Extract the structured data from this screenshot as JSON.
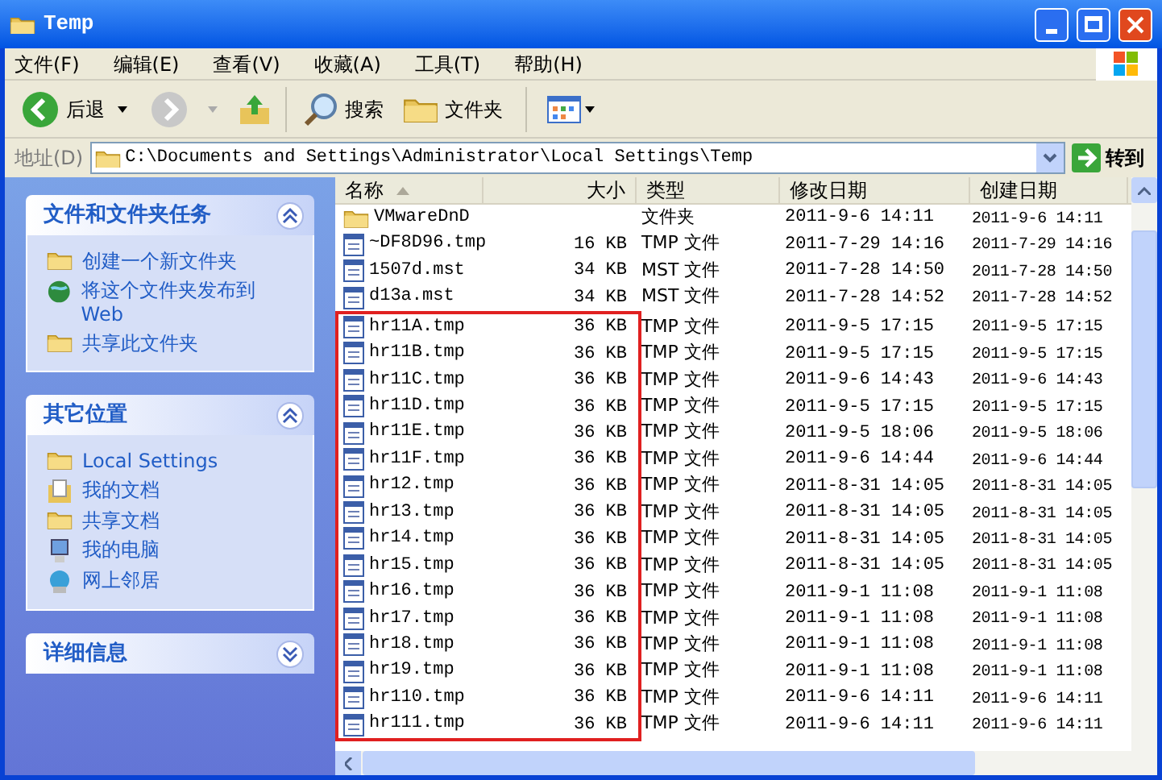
{
  "window": {
    "title": "Temp"
  },
  "menu": [
    "文件(F)",
    "编辑(E)",
    "查看(V)",
    "收藏(A)",
    "工具(T)",
    "帮助(H)"
  ],
  "toolbar": {
    "back": "后退",
    "search": "搜索",
    "folders": "文件夹"
  },
  "address": {
    "label": "地址(D)",
    "value": "C:\\Documents and Settings\\Administrator\\Local Settings\\Temp",
    "go": "转到"
  },
  "panels": [
    {
      "title": "文件和文件夹任务",
      "expanded": true,
      "items": [
        "创建一个新文件夹",
        "将这个文件夹发布到 Web",
        "共享此文件夹"
      ]
    },
    {
      "title": "其它位置",
      "expanded": true,
      "items": [
        "Local Settings",
        "我的文档",
        "共享文档",
        "我的电脑",
        "网上邻居"
      ]
    },
    {
      "title": "详细信息",
      "expanded": false
    }
  ],
  "columns": [
    {
      "label": "名称",
      "sorted": true
    },
    {
      "label": "大小",
      "sorted": false
    },
    {
      "label": "类型",
      "sorted": false
    },
    {
      "label": "修改日期",
      "sorted": false
    },
    {
      "label": "创建日期",
      "sorted": false
    }
  ],
  "rows": [
    {
      "kind": "folder",
      "name": "VMwareDnD",
      "size": "",
      "type": "文件夹",
      "modified": "2011-9-6 14:11",
      "created": "2011-9-6 14:11",
      "marked": false
    },
    {
      "kind": "file",
      "name": "~DF8D96.tmp",
      "size": "16 KB",
      "type": "TMP 文件",
      "modified": "2011-7-29 14:16",
      "created": "2011-7-29 14:16",
      "marked": false
    },
    {
      "kind": "file",
      "name": "1507d.mst",
      "size": "34 KB",
      "type": "MST 文件",
      "modified": "2011-7-28 14:50",
      "created": "2011-7-28 14:50",
      "marked": false
    },
    {
      "kind": "file",
      "name": "d13a.mst",
      "size": "34 KB",
      "type": "MST 文件",
      "modified": "2011-7-28 14:52",
      "created": "2011-7-28 14:52",
      "marked": false
    },
    {
      "kind": "file",
      "name": "hr11A.tmp",
      "size": "36 KB",
      "type": "TMP 文件",
      "modified": "2011-9-5 17:15",
      "created": "2011-9-5 17:15",
      "marked": true
    },
    {
      "kind": "file",
      "name": "hr11B.tmp",
      "size": "36 KB",
      "type": "TMP 文件",
      "modified": "2011-9-5 17:15",
      "created": "2011-9-5 17:15",
      "marked": true
    },
    {
      "kind": "file",
      "name": "hr11C.tmp",
      "size": "36 KB",
      "type": "TMP 文件",
      "modified": "2011-9-6 14:43",
      "created": "2011-9-6 14:43",
      "marked": true
    },
    {
      "kind": "file",
      "name": "hr11D.tmp",
      "size": "36 KB",
      "type": "TMP 文件",
      "modified": "2011-9-5 17:15",
      "created": "2011-9-5 17:15",
      "marked": true
    },
    {
      "kind": "file",
      "name": "hr11E.tmp",
      "size": "36 KB",
      "type": "TMP 文件",
      "modified": "2011-9-5 18:06",
      "created": "2011-9-5 18:06",
      "marked": true
    },
    {
      "kind": "file",
      "name": "hr11F.tmp",
      "size": "36 KB",
      "type": "TMP 文件",
      "modified": "2011-9-6 14:44",
      "created": "2011-9-6 14:44",
      "marked": true
    },
    {
      "kind": "file",
      "name": "hr12.tmp",
      "size": "36 KB",
      "type": "TMP 文件",
      "modified": "2011-8-31 14:05",
      "created": "2011-8-31 14:05",
      "marked": true
    },
    {
      "kind": "file",
      "name": "hr13.tmp",
      "size": "36 KB",
      "type": "TMP 文件",
      "modified": "2011-8-31 14:05",
      "created": "2011-8-31 14:05",
      "marked": true
    },
    {
      "kind": "file",
      "name": "hr14.tmp",
      "size": "36 KB",
      "type": "TMP 文件",
      "modified": "2011-8-31 14:05",
      "created": "2011-8-31 14:05",
      "marked": true
    },
    {
      "kind": "file",
      "name": "hr15.tmp",
      "size": "36 KB",
      "type": "TMP 文件",
      "modified": "2011-8-31 14:05",
      "created": "2011-8-31 14:05",
      "marked": true
    },
    {
      "kind": "file",
      "name": "hr16.tmp",
      "size": "36 KB",
      "type": "TMP 文件",
      "modified": "2011-9-1 11:08",
      "created": "2011-9-1 11:08",
      "marked": true
    },
    {
      "kind": "file",
      "name": "hr17.tmp",
      "size": "36 KB",
      "type": "TMP 文件",
      "modified": "2011-9-1 11:08",
      "created": "2011-9-1 11:08",
      "marked": true
    },
    {
      "kind": "file",
      "name": "hr18.tmp",
      "size": "36 KB",
      "type": "TMP 文件",
      "modified": "2011-9-1 11:08",
      "created": "2011-9-1 11:08",
      "marked": true
    },
    {
      "kind": "file",
      "name": "hr19.tmp",
      "size": "36 KB",
      "type": "TMP 文件",
      "modified": "2011-9-1 11:08",
      "created": "2011-9-1 11:08",
      "marked": true
    },
    {
      "kind": "file",
      "name": "hr110.tmp",
      "size": "36 KB",
      "type": "TMP 文件",
      "modified": "2011-9-6 14:11",
      "created": "2011-9-6 14:11",
      "marked": true
    },
    {
      "kind": "file",
      "name": "hr111.tmp",
      "size": "36 KB",
      "type": "TMP 文件",
      "modified": "2011-9-6 14:11",
      "created": "2011-9-6 14:11",
      "marked": true
    }
  ]
}
